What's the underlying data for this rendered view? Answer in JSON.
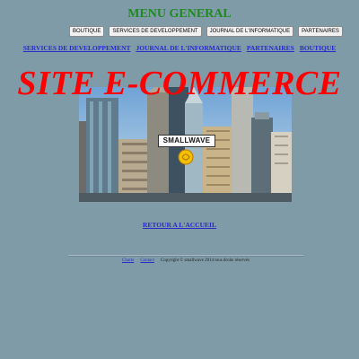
{
  "header": {
    "title": "MENU GENERAL"
  },
  "buttons": [
    "BOUTIQUE",
    "SERVICES DE DEVELOPPEMENT",
    "JOURNAL DE L'INFORMATIQUE",
    "PARTENAIRES"
  ],
  "links": [
    "SERVICES DE DEVELOPPEMENT",
    "JOURNAL DE L'INFORMATIQUE",
    "PARTENAIRES",
    "BOUTIQUE"
  ],
  "hero": {
    "headline": "SITE E-COMMERCE",
    "logo_text": "SMALLWAVE"
  },
  "back_link": "RETOUR A L'ACCUEIL",
  "footer": {
    "charte": "Charte",
    "contact": "Contact",
    "copyright": "Copyright  © smallwave 2014 tous droits réservés"
  },
  "colors": {
    "background": "#7f9ba8",
    "title": "#1f8a1f",
    "headline": "#ff0000",
    "link": "#2b2bc8"
  }
}
